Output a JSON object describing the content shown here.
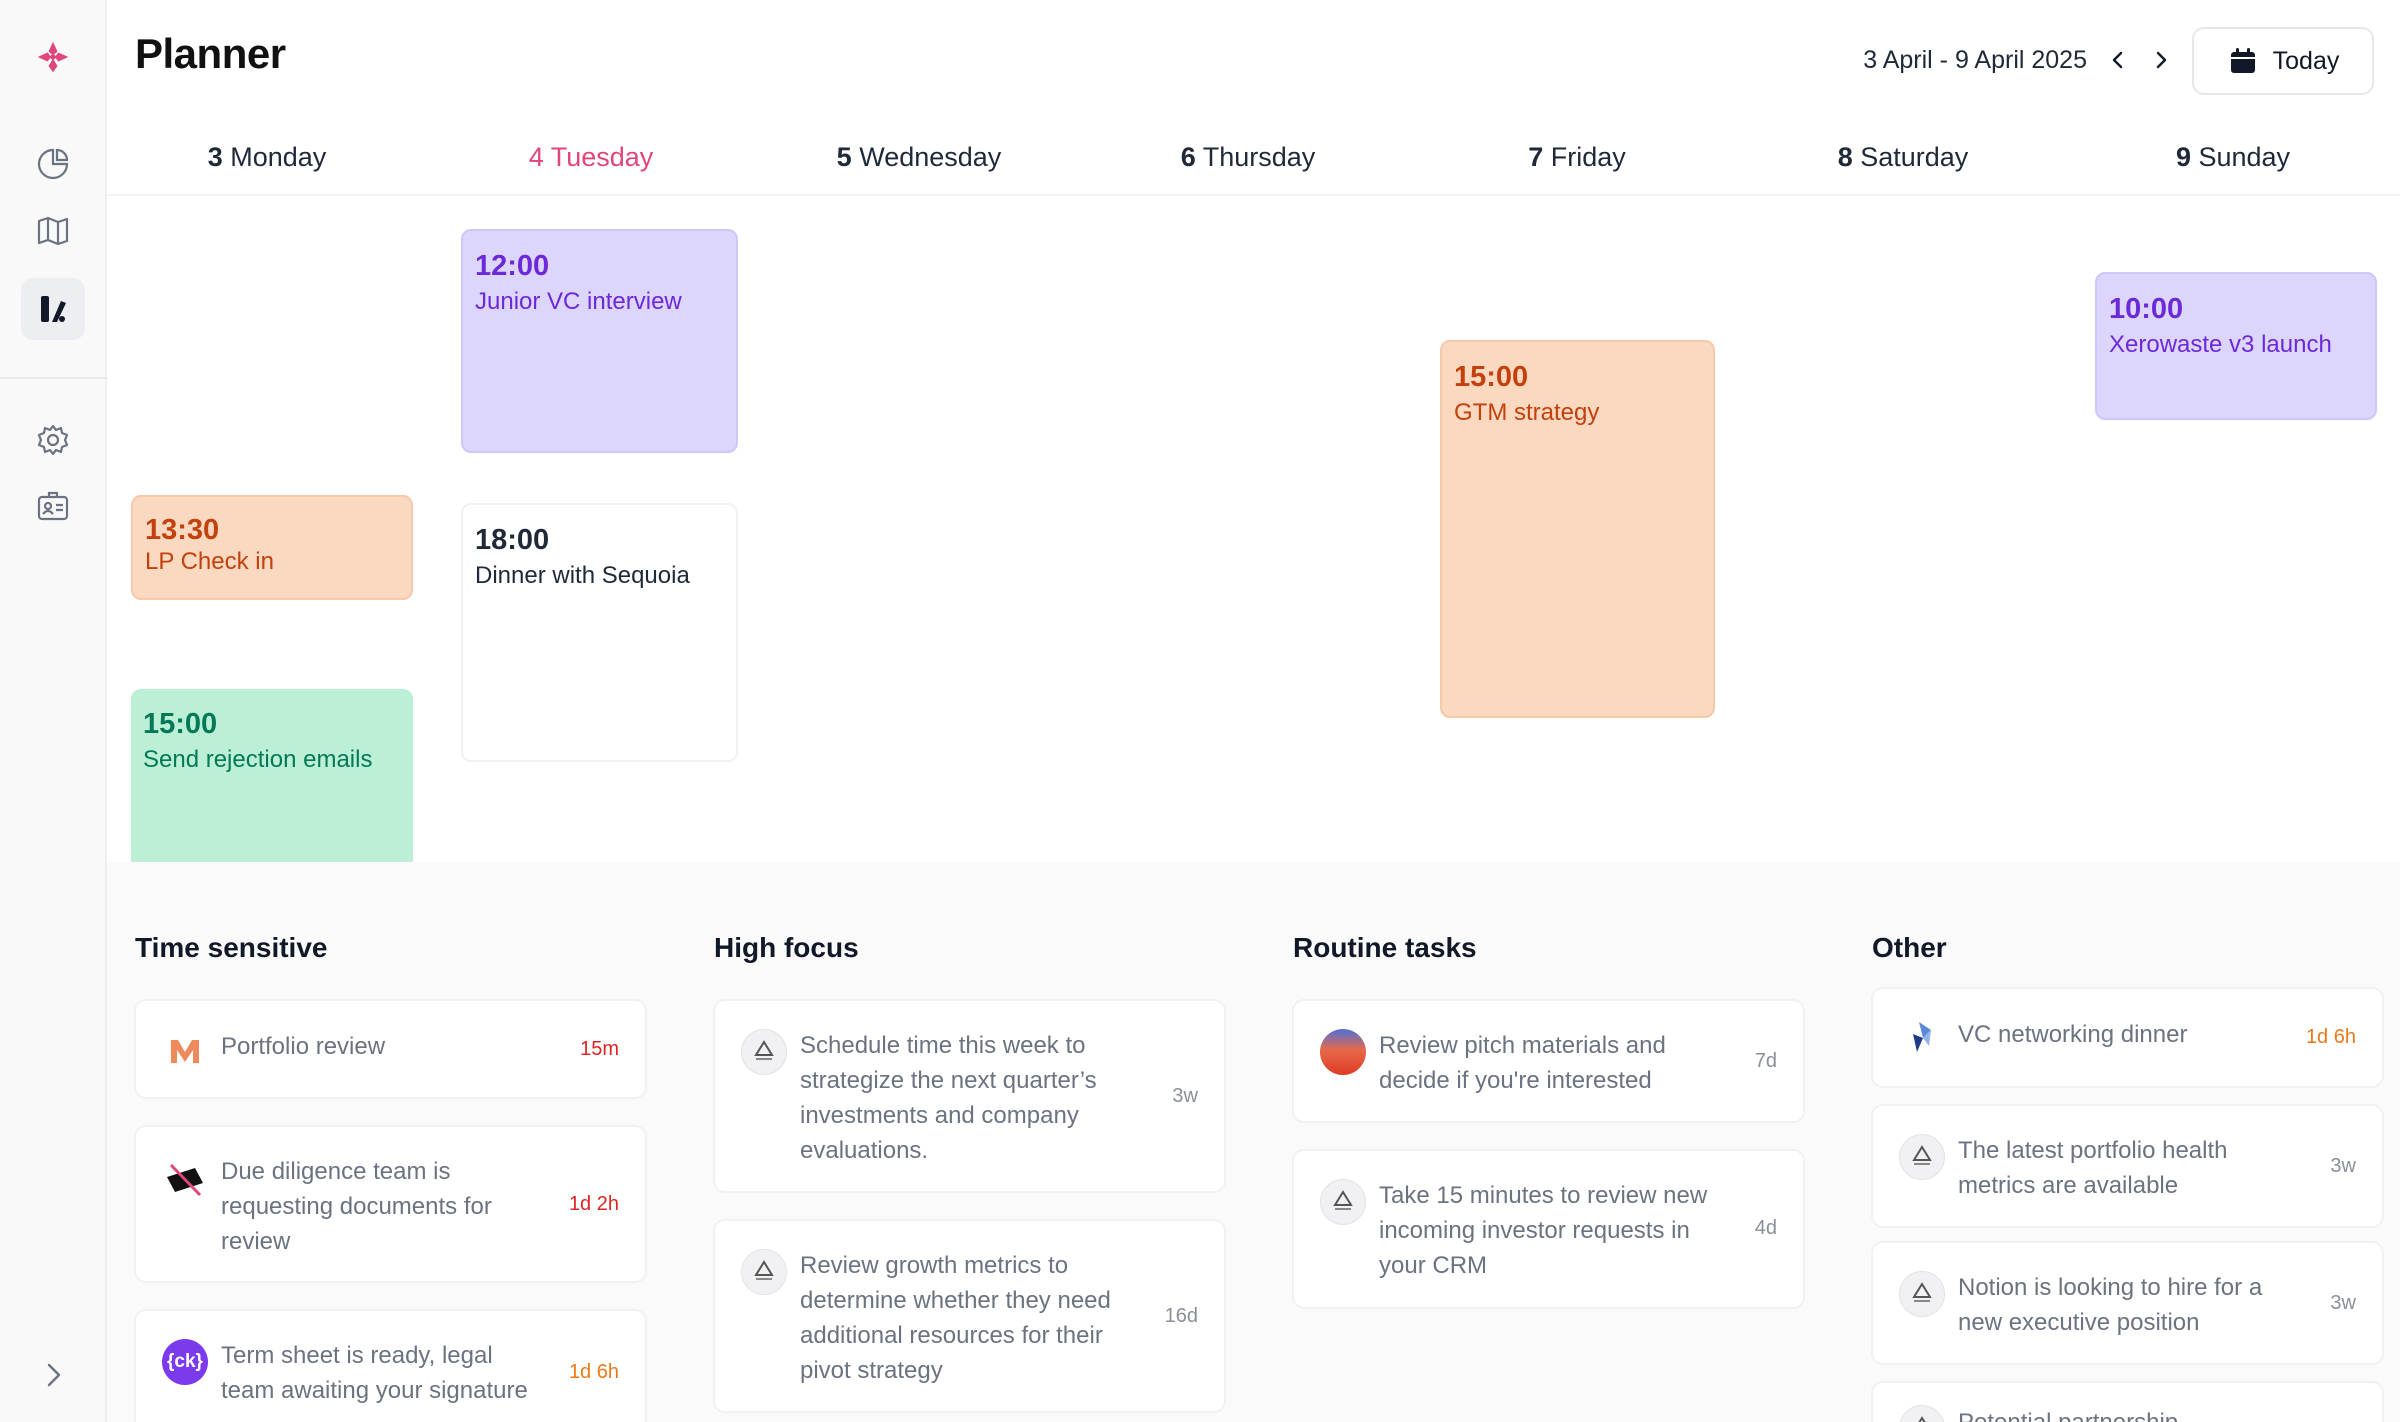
{
  "header": {
    "title": "Planner",
    "date_range": "3 April - 9 April 2025",
    "today_label": "Today"
  },
  "days": [
    {
      "num": "3",
      "name": "Monday",
      "today": false
    },
    {
      "num": "4",
      "name": "Tuesday",
      "today": true
    },
    {
      "num": "5",
      "name": "Wednesday",
      "today": false
    },
    {
      "num": "6",
      "name": "Thursday",
      "today": false
    },
    {
      "num": "7",
      "name": "Friday",
      "today": false
    },
    {
      "num": "8",
      "name": "Saturday",
      "today": false
    },
    {
      "num": "9",
      "name": "Sunday",
      "today": false
    }
  ],
  "events": [
    {
      "time": "12:00",
      "title": "Junior VC interview",
      "day": "Tuesday",
      "color": "#dcd6fd"
    },
    {
      "time": "18:00",
      "title": "Dinner with Sequoia",
      "day": "Tuesday",
      "color": "#ffffff"
    },
    {
      "time": "13:30",
      "title": "LP Check in",
      "day": "Monday",
      "color": "#fbd8c0"
    },
    {
      "time": "15:00",
      "title": "Send rejection emails",
      "day": "Monday",
      "color": "#bbf0d7"
    },
    {
      "time": "15:00",
      "title": "GTM strategy",
      "day": "Friday",
      "color": "#fbd8c0"
    },
    {
      "time": "10:00",
      "title": "Xerowaste v3 launch",
      "day": "Sunday",
      "color": "#dcd6fd"
    }
  ],
  "columns": [
    {
      "title": "Time sensitive",
      "tasks": [
        {
          "text": "Portfolio review",
          "age": "15m",
          "logo": "m-logo"
        },
        {
          "text": "Due diligence team is requesting documents for review",
          "age": "1d 2h",
          "logo": "slash-logo"
        },
        {
          "text": "Term sheet is ready, legal team awaiting your signature",
          "age": "1d 6h",
          "logo": "ck-logo",
          "logo_text": "{ck}"
        }
      ]
    },
    {
      "title": "High focus",
      "tasks": [
        {
          "text": "Schedule time this week to strategize the next quarter’s investments and company evaluations.",
          "age": "3w",
          "logo": "acme-corp-logo"
        },
        {
          "text": "Review growth metrics to determine whether they need additional resources for their pivot strategy",
          "age": "16d",
          "logo": "acme-corp-logo"
        }
      ]
    },
    {
      "title": "Routine tasks",
      "tasks": [
        {
          "text": "Review pitch materials and decide if you're interested",
          "age": "7d",
          "logo": "sunset-logo"
        },
        {
          "text": "Take 15 minutes to review new incoming investor requests in your CRM",
          "age": "4d",
          "logo": "acme-corp-logo"
        }
      ]
    },
    {
      "title": "Other",
      "tasks": [
        {
          "text": "VC networking dinner",
          "age": "1d 6h",
          "logo": "prism-logo"
        },
        {
          "text": "The latest portfolio health metrics are available",
          "age": "3w",
          "logo": "acme-corp-logo"
        },
        {
          "text": "Notion is looking to hire for a new executive position",
          "age": "3w",
          "logo": "acme-corp-logo"
        },
        {
          "text": "Potential partnership",
          "age": "",
          "logo": "acme-corp-logo"
        }
      ]
    }
  ],
  "colors": {
    "today_accent": "#e0457b",
    "brand": "#e0457b",
    "urgent": "#dc2626",
    "warning": "#ea7a1a"
  },
  "icons": {
    "sidebar": [
      "brand-logo-icon",
      "analytics-pie-icon",
      "map-icon",
      "planner-icon",
      "settings-gear-icon",
      "contact-card-icon",
      "expand-chevron-icon"
    ]
  }
}
